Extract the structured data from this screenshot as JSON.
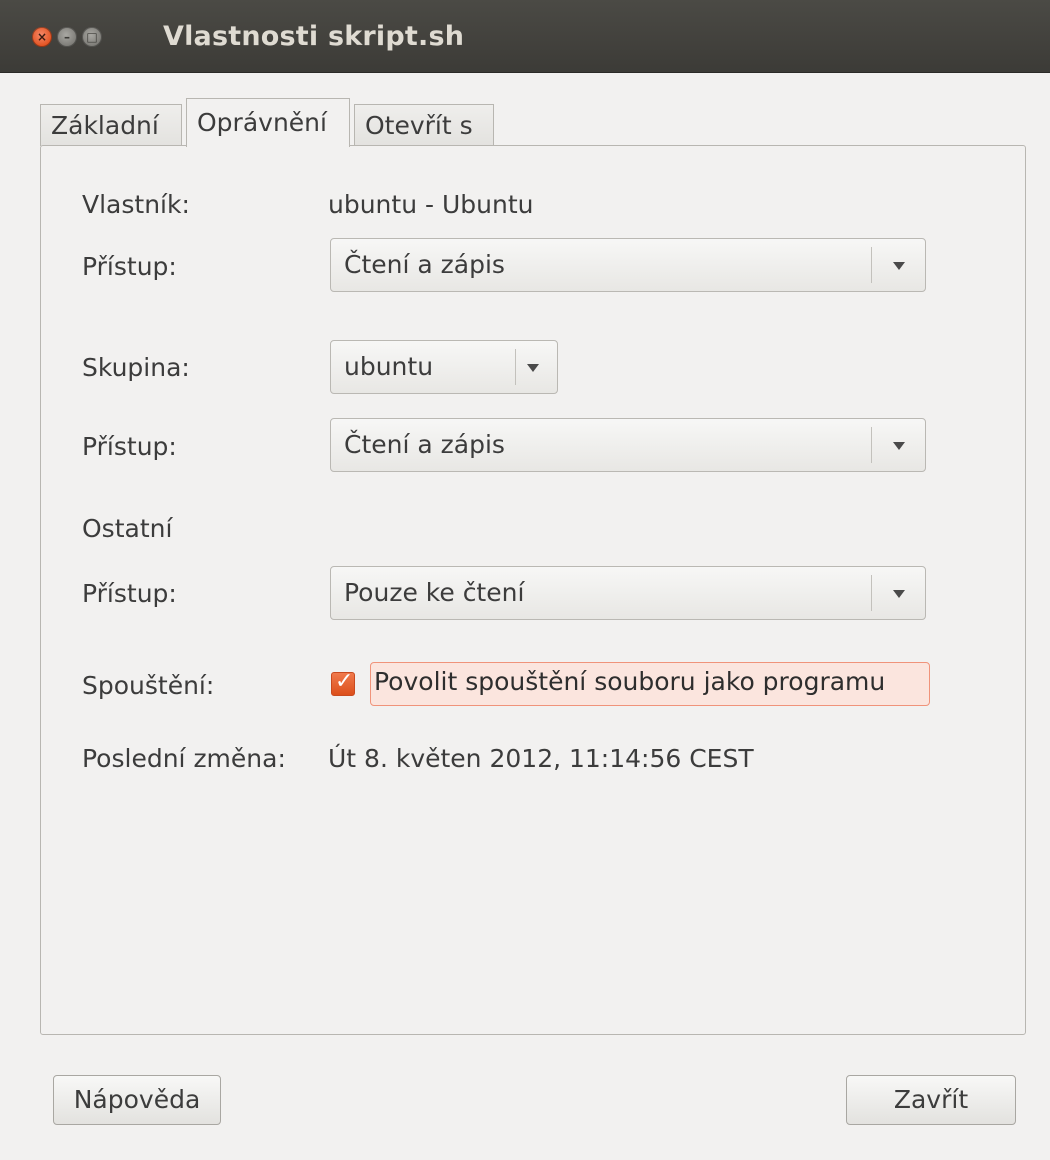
{
  "window": {
    "title": "Vlastnosti skript.sh",
    "close_glyph": "×",
    "min_glyph": "–",
    "max_glyph": "□"
  },
  "tabs": [
    {
      "label": "Základní",
      "active": false
    },
    {
      "label": "Oprávnění",
      "active": true
    },
    {
      "label": "Otevřít s",
      "active": false
    }
  ],
  "permissions": {
    "owner_label": "Vlastník:",
    "owner_value": "ubuntu - Ubuntu",
    "owner_access_label": "Přístup:",
    "owner_access_value": "Čtení a zápis",
    "group_label": "Skupina:",
    "group_value": "ubuntu",
    "group_access_label": "Přístup:",
    "group_access_value": "Čtení a zápis",
    "others_label": "Ostatní",
    "others_access_label": "Přístup:",
    "others_access_value": "Pouze ke čtení",
    "execute_label": "Spouštění:",
    "execute_checkbox_label": "Povolit spouštění souboru jako programu",
    "execute_checked": true,
    "modified_label": "Poslední změna:",
    "modified_value": "Út 8. květen 2012, 11:14:56 CEST"
  },
  "buttons": {
    "help": "Nápověda",
    "close": "Zavřít"
  },
  "colors": {
    "accent": "#dd4814",
    "titlebar": "#3c3b37"
  }
}
